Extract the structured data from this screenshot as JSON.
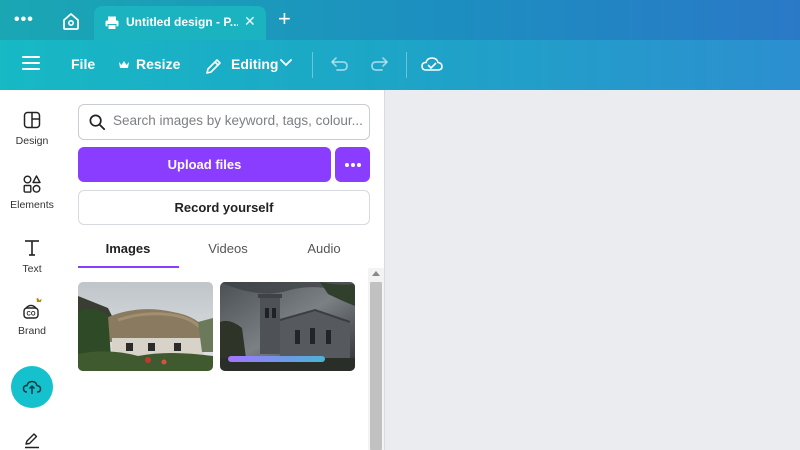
{
  "browser": {
    "tab_title": "Untitled design - P...",
    "tab_close": "✕",
    "new_tab": "+"
  },
  "toolbar": {
    "file": "File",
    "resize": "Resize",
    "editing": "Editing"
  },
  "rail": {
    "items": [
      {
        "label": "Design",
        "icon": "layout-icon"
      },
      {
        "label": "Elements",
        "icon": "shapes-icon"
      },
      {
        "label": "Text",
        "icon": "text-icon"
      },
      {
        "label": "Brand",
        "icon": "brand-icon"
      }
    ]
  },
  "panel": {
    "search_placeholder": "Search images by keyword, tags, colour...",
    "upload_label": "Upload files",
    "record_label": "Record yourself",
    "tabs": [
      {
        "label": "Images",
        "active": true
      },
      {
        "label": "Videos",
        "active": false
      },
      {
        "label": "Audio",
        "active": false
      }
    ]
  },
  "colors": {
    "accent_purple": "#8b3dff",
    "toolbar_teal": "#17b9c5",
    "upload_fab": "#14c1cc"
  }
}
